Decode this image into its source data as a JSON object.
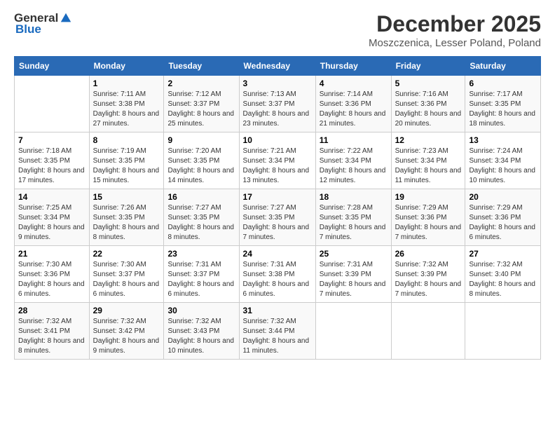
{
  "logo": {
    "general": "General",
    "blue": "Blue"
  },
  "header": {
    "title": "December 2025",
    "location": "Moszczenica, Lesser Poland, Poland"
  },
  "days_of_week": [
    "Sunday",
    "Monday",
    "Tuesday",
    "Wednesday",
    "Thursday",
    "Friday",
    "Saturday"
  ],
  "weeks": [
    [
      {
        "day": "",
        "sunrise": "",
        "sunset": "",
        "daylight": ""
      },
      {
        "day": "1",
        "sunrise": "Sunrise: 7:11 AM",
        "sunset": "Sunset: 3:38 PM",
        "daylight": "Daylight: 8 hours and 27 minutes."
      },
      {
        "day": "2",
        "sunrise": "Sunrise: 7:12 AM",
        "sunset": "Sunset: 3:37 PM",
        "daylight": "Daylight: 8 hours and 25 minutes."
      },
      {
        "day": "3",
        "sunrise": "Sunrise: 7:13 AM",
        "sunset": "Sunset: 3:37 PM",
        "daylight": "Daylight: 8 hours and 23 minutes."
      },
      {
        "day": "4",
        "sunrise": "Sunrise: 7:14 AM",
        "sunset": "Sunset: 3:36 PM",
        "daylight": "Daylight: 8 hours and 21 minutes."
      },
      {
        "day": "5",
        "sunrise": "Sunrise: 7:16 AM",
        "sunset": "Sunset: 3:36 PM",
        "daylight": "Daylight: 8 hours and 20 minutes."
      },
      {
        "day": "6",
        "sunrise": "Sunrise: 7:17 AM",
        "sunset": "Sunset: 3:35 PM",
        "daylight": "Daylight: 8 hours and 18 minutes."
      }
    ],
    [
      {
        "day": "7",
        "sunrise": "Sunrise: 7:18 AM",
        "sunset": "Sunset: 3:35 PM",
        "daylight": "Daylight: 8 hours and 17 minutes."
      },
      {
        "day": "8",
        "sunrise": "Sunrise: 7:19 AM",
        "sunset": "Sunset: 3:35 PM",
        "daylight": "Daylight: 8 hours and 15 minutes."
      },
      {
        "day": "9",
        "sunrise": "Sunrise: 7:20 AM",
        "sunset": "Sunset: 3:35 PM",
        "daylight": "Daylight: 8 hours and 14 minutes."
      },
      {
        "day": "10",
        "sunrise": "Sunrise: 7:21 AM",
        "sunset": "Sunset: 3:34 PM",
        "daylight": "Daylight: 8 hours and 13 minutes."
      },
      {
        "day": "11",
        "sunrise": "Sunrise: 7:22 AM",
        "sunset": "Sunset: 3:34 PM",
        "daylight": "Daylight: 8 hours and 12 minutes."
      },
      {
        "day": "12",
        "sunrise": "Sunrise: 7:23 AM",
        "sunset": "Sunset: 3:34 PM",
        "daylight": "Daylight: 8 hours and 11 minutes."
      },
      {
        "day": "13",
        "sunrise": "Sunrise: 7:24 AM",
        "sunset": "Sunset: 3:34 PM",
        "daylight": "Daylight: 8 hours and 10 minutes."
      }
    ],
    [
      {
        "day": "14",
        "sunrise": "Sunrise: 7:25 AM",
        "sunset": "Sunset: 3:34 PM",
        "daylight": "Daylight: 8 hours and 9 minutes."
      },
      {
        "day": "15",
        "sunrise": "Sunrise: 7:26 AM",
        "sunset": "Sunset: 3:35 PM",
        "daylight": "Daylight: 8 hours and 8 minutes."
      },
      {
        "day": "16",
        "sunrise": "Sunrise: 7:27 AM",
        "sunset": "Sunset: 3:35 PM",
        "daylight": "Daylight: 8 hours and 8 minutes."
      },
      {
        "day": "17",
        "sunrise": "Sunrise: 7:27 AM",
        "sunset": "Sunset: 3:35 PM",
        "daylight": "Daylight: 8 hours and 7 minutes."
      },
      {
        "day": "18",
        "sunrise": "Sunrise: 7:28 AM",
        "sunset": "Sunset: 3:35 PM",
        "daylight": "Daylight: 8 hours and 7 minutes."
      },
      {
        "day": "19",
        "sunrise": "Sunrise: 7:29 AM",
        "sunset": "Sunset: 3:36 PM",
        "daylight": "Daylight: 8 hours and 7 minutes."
      },
      {
        "day": "20",
        "sunrise": "Sunrise: 7:29 AM",
        "sunset": "Sunset: 3:36 PM",
        "daylight": "Daylight: 8 hours and 6 minutes."
      }
    ],
    [
      {
        "day": "21",
        "sunrise": "Sunrise: 7:30 AM",
        "sunset": "Sunset: 3:36 PM",
        "daylight": "Daylight: 8 hours and 6 minutes."
      },
      {
        "day": "22",
        "sunrise": "Sunrise: 7:30 AM",
        "sunset": "Sunset: 3:37 PM",
        "daylight": "Daylight: 8 hours and 6 minutes."
      },
      {
        "day": "23",
        "sunrise": "Sunrise: 7:31 AM",
        "sunset": "Sunset: 3:37 PM",
        "daylight": "Daylight: 8 hours and 6 minutes."
      },
      {
        "day": "24",
        "sunrise": "Sunrise: 7:31 AM",
        "sunset": "Sunset: 3:38 PM",
        "daylight": "Daylight: 8 hours and 6 minutes."
      },
      {
        "day": "25",
        "sunrise": "Sunrise: 7:31 AM",
        "sunset": "Sunset: 3:39 PM",
        "daylight": "Daylight: 8 hours and 7 minutes."
      },
      {
        "day": "26",
        "sunrise": "Sunrise: 7:32 AM",
        "sunset": "Sunset: 3:39 PM",
        "daylight": "Daylight: 8 hours and 7 minutes."
      },
      {
        "day": "27",
        "sunrise": "Sunrise: 7:32 AM",
        "sunset": "Sunset: 3:40 PM",
        "daylight": "Daylight: 8 hours and 8 minutes."
      }
    ],
    [
      {
        "day": "28",
        "sunrise": "Sunrise: 7:32 AM",
        "sunset": "Sunset: 3:41 PM",
        "daylight": "Daylight: 8 hours and 8 minutes."
      },
      {
        "day": "29",
        "sunrise": "Sunrise: 7:32 AM",
        "sunset": "Sunset: 3:42 PM",
        "daylight": "Daylight: 8 hours and 9 minutes."
      },
      {
        "day": "30",
        "sunrise": "Sunrise: 7:32 AM",
        "sunset": "Sunset: 3:43 PM",
        "daylight": "Daylight: 8 hours and 10 minutes."
      },
      {
        "day": "31",
        "sunrise": "Sunrise: 7:32 AM",
        "sunset": "Sunset: 3:44 PM",
        "daylight": "Daylight: 8 hours and 11 minutes."
      },
      {
        "day": "",
        "sunrise": "",
        "sunset": "",
        "daylight": ""
      },
      {
        "day": "",
        "sunrise": "",
        "sunset": "",
        "daylight": ""
      },
      {
        "day": "",
        "sunrise": "",
        "sunset": "",
        "daylight": ""
      }
    ]
  ]
}
